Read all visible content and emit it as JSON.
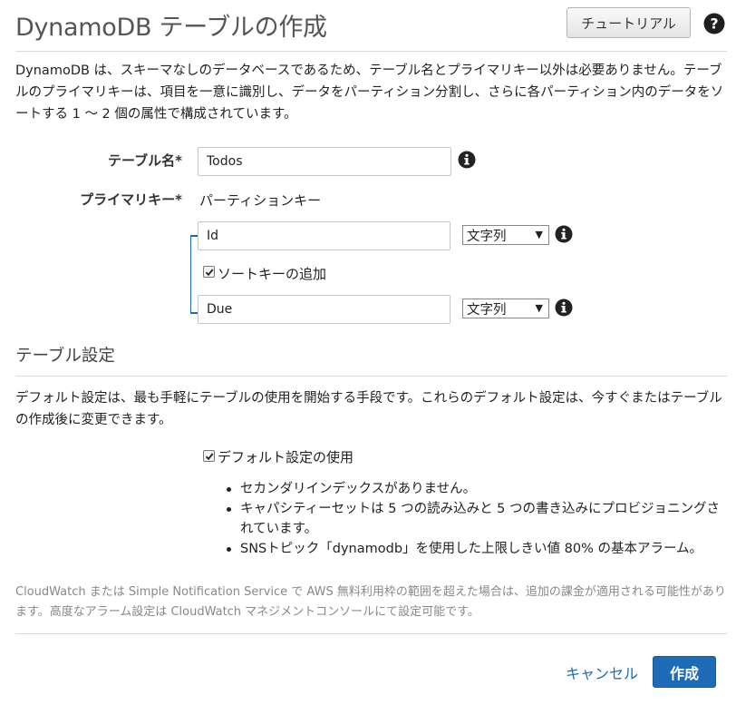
{
  "header": {
    "title": "DynamoDB テーブルの作成",
    "tutorial_label": "チュートリアル",
    "help_icon": "help-circle-icon"
  },
  "intro": {
    "text": "DynamoDB は、スキーマなしのデータベースであるため、テーブル名とプライマリキー以外は必要ありません。テーブルのプライマリキーは、項目を一意に識別し、データをパーティション分割し、さらに各パーティション内のデータをソートする 1 〜 2 個の属性で構成されています。"
  },
  "form": {
    "table_name_label": "テーブル名*",
    "table_name_value": "Todos",
    "primary_key_label": "プライマリキー*",
    "partition_key_label": "パーティションキー",
    "partition_key_value": "Id",
    "partition_key_type": "文字列",
    "add_sort_key_label": "ソートキーの追加",
    "add_sort_key_checked": true,
    "sort_key_value": "Due",
    "sort_key_type": "文字列",
    "info_icon": "info-circle-icon"
  },
  "settings": {
    "section_title": "テーブル設定",
    "description": "デフォルト設定は、最も手軽にテーブルの使用を開始する手段です。これらのデフォルト設定は、今すぐまたはテーブルの作成後に変更できます。",
    "use_default_label": "デフォルト設定の使用",
    "use_default_checked": true,
    "bullets": [
      "セカンダリインデックスがありません。",
      "キャパシティーセットは 5 つの読み込みと 5 つの書き込みにプロビジョニングされています。",
      "SNSトピック「dynamodb」を使用した上限しきい値 80% の基本アラーム。"
    ]
  },
  "note": {
    "text": "CloudWatch または Simple Notification Service で AWS 無料利用枠の範囲を超えた場合は、追加の課金が適用される可能性があります。高度なアラーム設定は CloudWatch マネジメントコンソールにて設定可能です。"
  },
  "footer": {
    "cancel_label": "キャンセル",
    "create_label": "作成"
  },
  "colors": {
    "accent": "#1e6bb8",
    "link": "#1a6bb8"
  }
}
